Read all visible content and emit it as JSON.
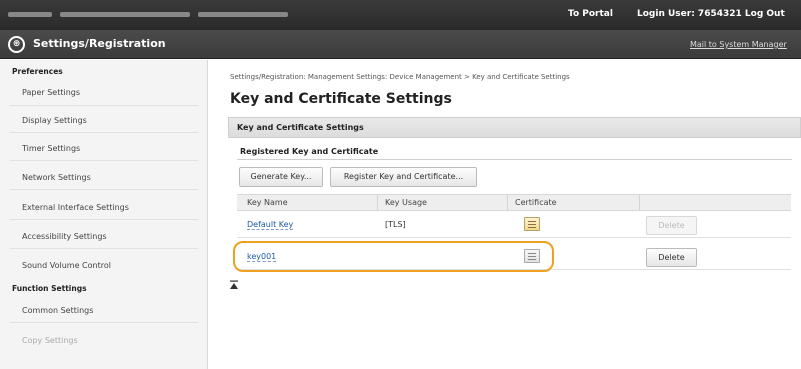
{
  "topbar": {
    "portal_label": "To Portal",
    "login_label": "Login User:  7654321  Log Out"
  },
  "titlebar": {
    "title": "Settings/Registration",
    "mail_label": "Mail to System Manager"
  },
  "sidebar": {
    "preferences_header": "Preferences",
    "preferences_items": [
      "Paper Settings",
      "Display Settings",
      "Timer Settings",
      "Network Settings",
      "External Interface Settings",
      "Accessibility Settings",
      "Sound Volume Control"
    ],
    "function_header": "Function Settings",
    "function_items": [
      "Common Settings",
      "Copy Settings"
    ]
  },
  "main": {
    "breadcrumb": "Settings/Registration: Management Settings: Device Management > Key and Certificate Settings",
    "page_title": "Key and Certificate Settings",
    "section_title": "Key and Certificate Settings",
    "subsection_title": "Registered Key and Certificate",
    "generate_key_label": "Generate Key...",
    "register_label": "Register Key and Certificate...",
    "table": {
      "headers": [
        "Key Name",
        "Key Usage",
        "Certificate"
      ],
      "rows": [
        {
          "key_name": "Default Key",
          "key_usage": "[TLS]",
          "delete_label": "Delete",
          "delete_enabled": false
        },
        {
          "key_name": "key001",
          "key_usage": "",
          "delete_label": "Delete",
          "delete_enabled": true
        }
      ]
    }
  },
  "colors": {
    "topbar": "#2f2f2f",
    "link": "#1a5aa6",
    "highlight": "#f0a020"
  }
}
